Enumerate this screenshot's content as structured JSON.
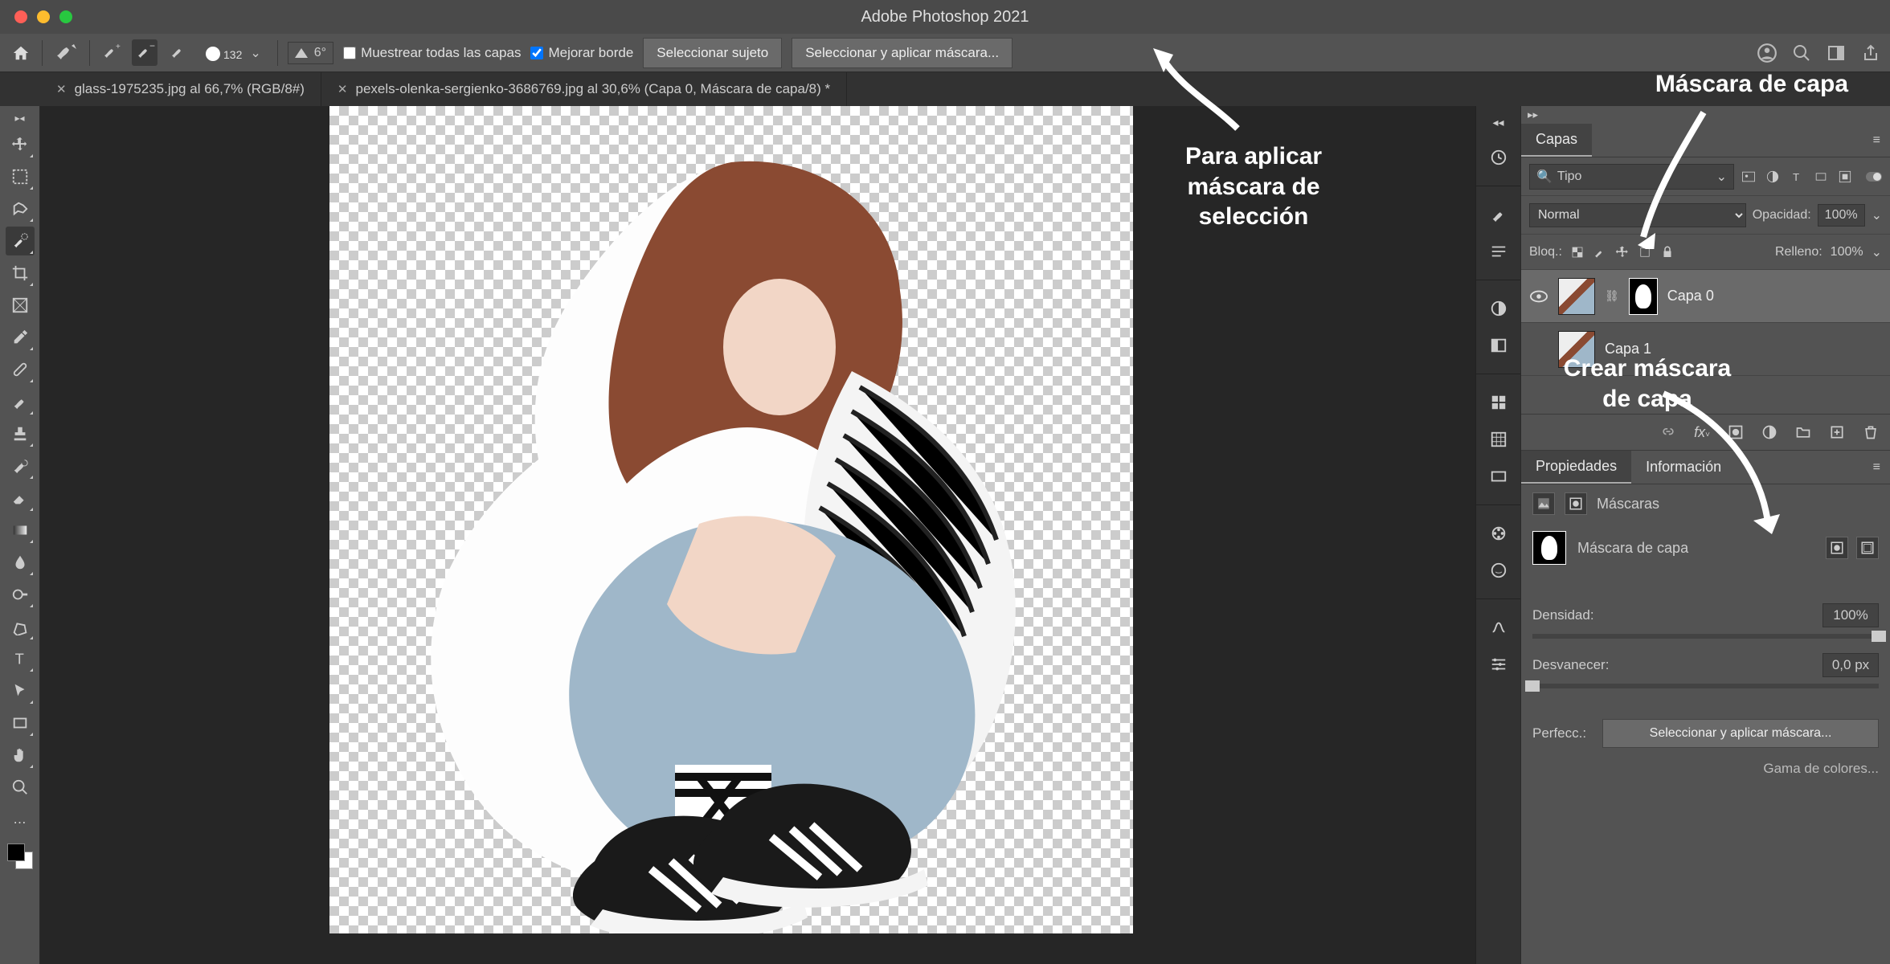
{
  "app_title": "Adobe Photoshop 2021",
  "optionbar": {
    "brush_size": "132",
    "angle_label": "6°",
    "sample_all_label": "Muestrear todas las capas",
    "enhance_edge_label": "Mejorar borde",
    "select_subject": "Seleccionar sujeto",
    "select_mask": "Seleccionar y aplicar máscara..."
  },
  "tabs": {
    "tab1": "glass-1975235.jpg al 66,7% (RGB/8#)",
    "tab2": "pexels-olenka-sergienko-3686769.jpg al 30,6% (Capa 0, Máscara de capa/8) *"
  },
  "annotations": {
    "apply_mask": "Para aplicar máscara de selección",
    "layer_mask": "Máscara de capa",
    "create_mask": "Crear máscara de capa"
  },
  "layers": {
    "panel": "Capas",
    "kind": "Tipo",
    "blend": "Normal",
    "opacity_label": "Opacidad:",
    "opacity_val": "100%",
    "lock_label": "Bloq.:",
    "fill_label": "Relleno:",
    "fill_val": "100%",
    "layer0": "Capa 0",
    "layer1": "Capa 1"
  },
  "properties": {
    "tab_props": "Propiedades",
    "tab_info": "Información",
    "masks": "Máscaras",
    "layer_mask": "Máscara de capa",
    "density": "Densidad:",
    "density_val": "100%",
    "feather": "Desvanecer:",
    "feather_val": "0,0 px",
    "refine": "Perfecc.:",
    "select_mask_btn": "Seleccionar y aplicar máscara...",
    "color_range": "Gama de colores..."
  }
}
